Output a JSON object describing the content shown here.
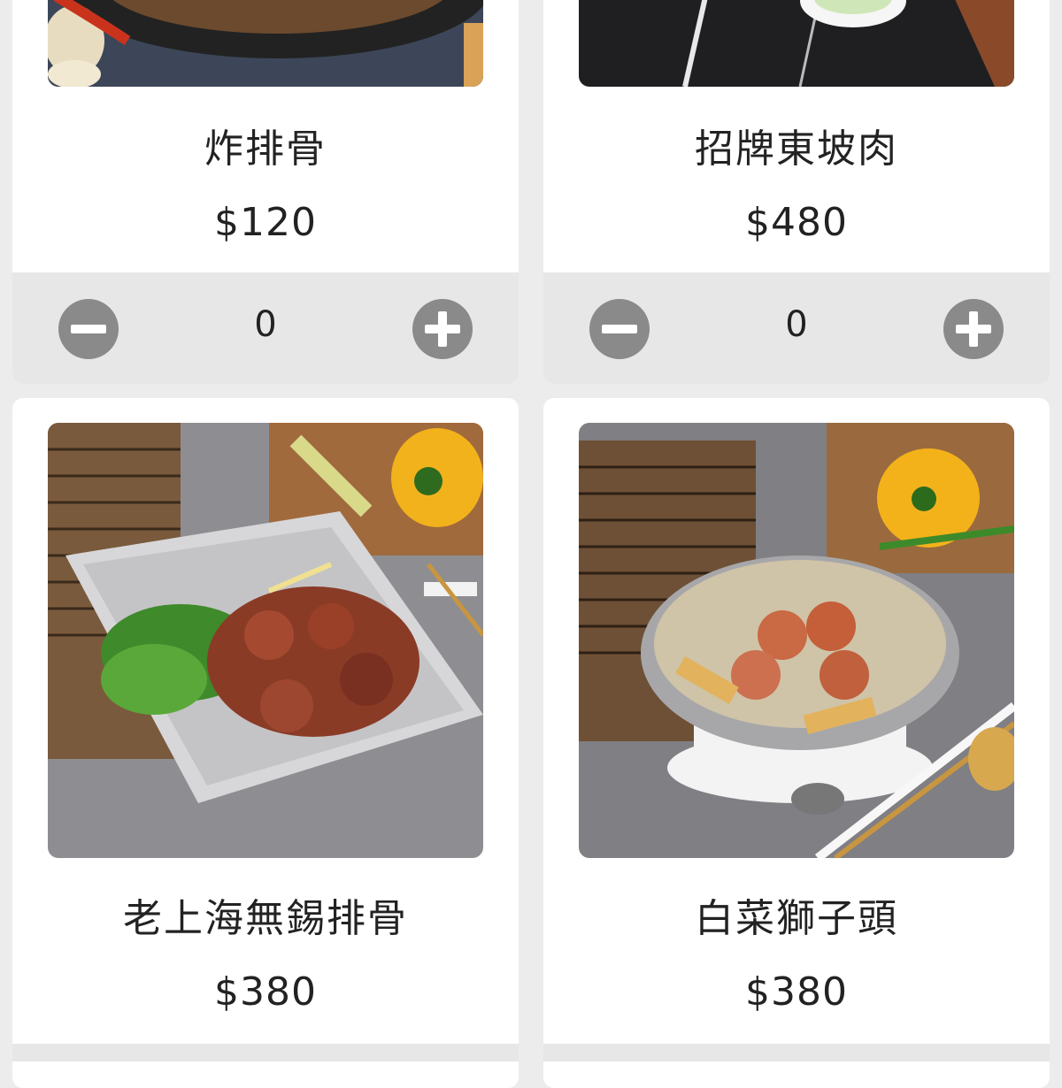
{
  "items": [
    {
      "name": "炸排骨",
      "price": "$120",
      "quantity": "0",
      "image_icon": "fried-pork-chop-photo"
    },
    {
      "name": "招牌東坡肉",
      "price": "$480",
      "quantity": "0",
      "image_icon": "dongpo-pork-photo"
    },
    {
      "name": "老上海無錫排骨",
      "price": "$380",
      "quantity": "",
      "image_icon": "wuxi-spare-ribs-photo"
    },
    {
      "name": "白菜獅子頭",
      "price": "$380",
      "quantity": "",
      "image_icon": "napa-cabbage-lions-head-photo"
    }
  ],
  "colors": {
    "page_bg": "#ececec",
    "card_bg": "#ffffff",
    "qty_bar_bg": "#e7e7e7",
    "qty_button": "#8a8a8a"
  }
}
